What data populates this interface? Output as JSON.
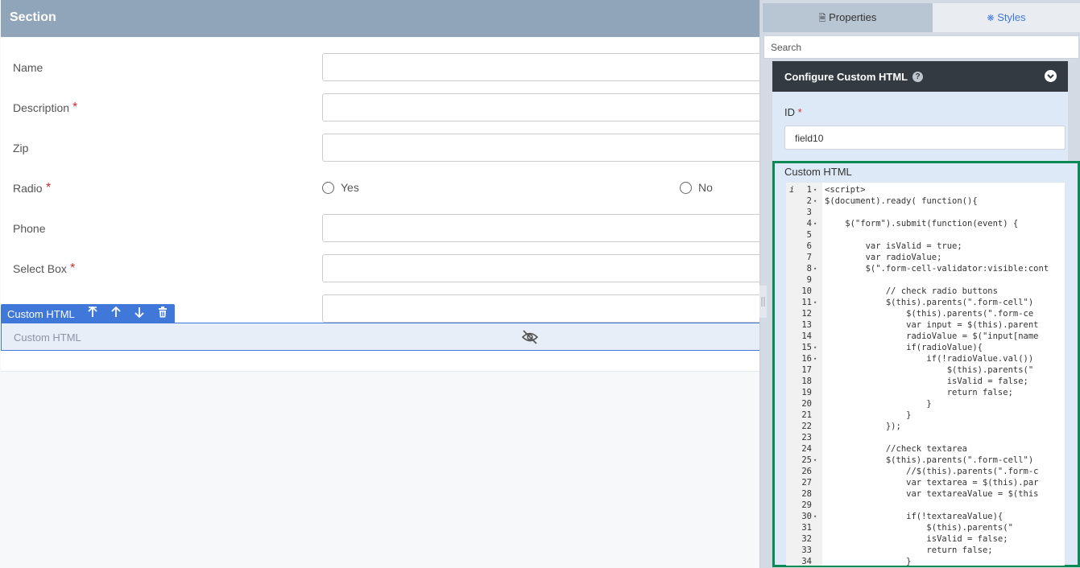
{
  "section": {
    "title": "Section"
  },
  "form": {
    "fields": [
      {
        "label": "Name",
        "required": false,
        "type": "input"
      },
      {
        "label": "Description",
        "required": true,
        "type": "input"
      },
      {
        "label": "Zip",
        "required": false,
        "type": "input"
      },
      {
        "label": "Radio",
        "required": true,
        "type": "radio",
        "options": [
          "Yes",
          "No"
        ]
      },
      {
        "label": "Phone",
        "required": false,
        "type": "input"
      },
      {
        "label": "Select Box",
        "required": true,
        "type": "input"
      },
      {
        "label": "",
        "required": false,
        "type": "input"
      }
    ],
    "required_marker": "*"
  },
  "element_toolbar": {
    "label": "Custom HTML"
  },
  "custom_html_element": {
    "placeholder": "Custom HTML"
  },
  "panel": {
    "tabs": {
      "properties": "Properties",
      "styles": "Styles"
    },
    "search_placeholder": "Search",
    "config_title": "Configure Custom HTML",
    "id_label": "ID",
    "id_value": "field10",
    "custom_html_label": "Custom HTML"
  },
  "editor": {
    "info_marker": "i",
    "lines": [
      "<script>",
      "$(document).ready( function(){",
      "",
      "    $(\"form\").submit(function(event) {",
      "",
      "        var isValid = true;",
      "        var radioValue;",
      "        $(\".form-cell-validator:visible:cont",
      "",
      "            // check radio buttons",
      "            $(this).parents(\".form-cell\")",
      "                $(this).parents(\".form-ce",
      "                var input = $(this).parent",
      "                radioValue = $(\"input[name",
      "                if(radioValue){",
      "                    if(!radioValue.val())",
      "                        $(this).parents(\"",
      "                        isValid = false;",
      "                        return false;",
      "                    }",
      "                }",
      "            });",
      "",
      "            //check textarea",
      "            $(this).parents(\".form-cell\")",
      "                //$(this).parents(\".form-c",
      "                var textarea = $(this).par",
      "                var textareaValue = $(this",
      "",
      "                if(!textareaValue){",
      "                    $(this).parents(\"",
      "                    isValid = false;",
      "                    return false;",
      "                }"
    ],
    "fold_lines": [
      1,
      2,
      4,
      8,
      11,
      15,
      16,
      25,
      30
    ]
  },
  "colors": {
    "section_header": "#91a5ba",
    "toolbar": "#3f78d9",
    "config_header": "#333a41",
    "highlight_border": "#0a8a55",
    "required": "#c9302c"
  }
}
